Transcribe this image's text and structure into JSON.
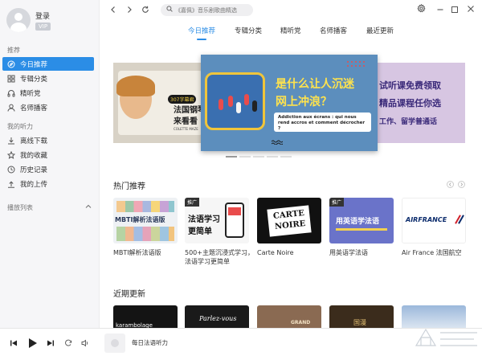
{
  "user": {
    "login_label": "登录",
    "vip_label": "VIP"
  },
  "sidebar": {
    "recommend_title": "推荐",
    "recommend_items": [
      {
        "label": "今日推荐",
        "icon": "compass-icon",
        "active": true
      },
      {
        "label": "专辑分类",
        "icon": "grid-icon",
        "active": false
      },
      {
        "label": "精听党",
        "icon": "headphones-icon",
        "active": false
      },
      {
        "label": "名师播客",
        "icon": "user-icon",
        "active": false
      }
    ],
    "mine_title": "我的听力",
    "mine_items": [
      {
        "label": "离线下载",
        "icon": "download-icon"
      },
      {
        "label": "我的收藏",
        "icon": "star-icon"
      },
      {
        "label": "历史记录",
        "icon": "clock-icon"
      },
      {
        "label": "我的上传",
        "icon": "upload-icon"
      }
    ],
    "playlist_title": "播放列表"
  },
  "search": {
    "placeholder": "《嘉佩》音乐剧歌曲精选"
  },
  "tabs": [
    {
      "label": "今日推荐",
      "active": true
    },
    {
      "label": "专辑分类",
      "active": false
    },
    {
      "label": "精听党",
      "active": false
    },
    {
      "label": "名师播客",
      "active": false
    },
    {
      "label": "最近更新",
      "active": false
    }
  ],
  "banner": {
    "left": {
      "tag": "307字幕君",
      "title_line1": "法国钢琴",
      "title_line2": "来看看",
      "subtitle": "COLETTE MAZE"
    },
    "center": {
      "headline_line1": "是什么让人沉迷",
      "headline_line2": "网上冲浪？",
      "french_text": "Addiction aux écrans : qui nous rend accros et comment décrocher ?"
    },
    "right": {
      "line1": "试听课免费领取",
      "line2": "精品课程任你选",
      "line3": "工作、留学普通话"
    }
  },
  "hot": {
    "title": "热门推荐",
    "items": [
      {
        "caption": "MBTI解析法语版",
        "thumb_text": "MBTI解析法语版",
        "promo": ""
      },
      {
        "caption": "500+主题沉浸式学习，法语学习更简单",
        "thumb_text_line1": "法语学习",
        "thumb_text_line2": "更简单",
        "promo": "推广"
      },
      {
        "caption": "Carte Noire",
        "thumb_text_line1": "CARTE",
        "thumb_text_line2": "NOIRE"
      },
      {
        "caption": "用英语学法语",
        "thumb_text": "用英语学法语",
        "promo": "推广"
      },
      {
        "caption": "Air France 法国航空",
        "thumb_text": "AIRFRANCE"
      }
    ]
  },
  "recent": {
    "title": "近期更新",
    "items": [
      {
        "thumb_text": "karambolage"
      },
      {
        "thumb_text": "Parlez-vous"
      },
      {
        "thumb_text": "GRAND"
      },
      {
        "thumb_text": "国漫"
      },
      {
        "thumb_text": ""
      }
    ]
  },
  "player": {
    "now_playing": "每日法语听力"
  },
  "colors": {
    "accent": "#2b8de6",
    "sidebar_bg": "#f6f6f8"
  }
}
